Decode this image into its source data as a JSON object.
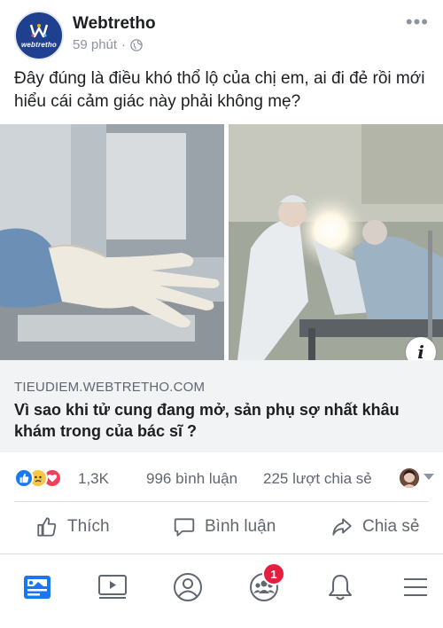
{
  "post": {
    "page_name": "Webtretho",
    "avatar_logo_text": "webtretho",
    "time": "59 phút",
    "separator": "·",
    "privacy_icon": "globe-icon",
    "text": "Đây đúng là điều khó thổ lộ của chị em, ai đi đẻ rồi mới hiểu cái cảm giác này phải không mẹ?"
  },
  "link": {
    "domain": "TIEUDIEM.WEBTRETHO.COM",
    "title": "Vì sao khi tử cung đang mở, sản phụ sợ nhất khâu khám trong của bác sĩ ?"
  },
  "stats": {
    "reactions": "1,3K",
    "comments": "996 bình luận",
    "shares": "225 lượt chia sẻ",
    "reaction_icons": [
      "like-icon",
      "sad-icon",
      "love-icon"
    ]
  },
  "actions": {
    "like": "Thích",
    "comment": "Bình luận",
    "share": "Chia sẻ"
  },
  "bottom_nav": {
    "items": [
      "news-feed-icon",
      "watch-icon",
      "profile-icon",
      "groups-icon",
      "notifications-icon",
      "menu-icon"
    ],
    "groups_badge": "1"
  },
  "colors": {
    "accent": "#1877f2",
    "text": "#1c1e21",
    "muted": "#606770",
    "badge": "#e41e3f"
  }
}
